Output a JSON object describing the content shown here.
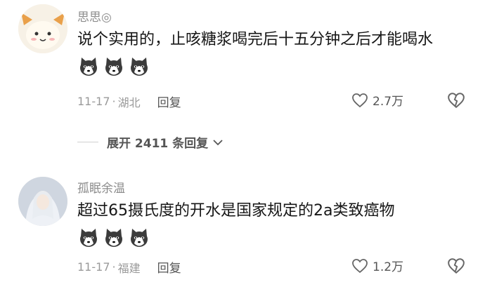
{
  "comments": [
    {
      "username": "思思◎",
      "text": "说个实用的，止咳糖浆喝完后十五分钟之后才能喝水",
      "emoji_count": 3,
      "emoji_icon": "husky-dog-emoji",
      "date": "11-17",
      "separator": "·",
      "location": "湖北",
      "reply_label": "回复",
      "likes": "2.7万"
    },
    {
      "username": "孤眠余温",
      "text": "超过65摄氏度的开水是国家规定的2a类致癌物",
      "emoji_count": 3,
      "emoji_icon": "husky-dog-emoji",
      "date": "11-17",
      "separator": "·",
      "location": "福建",
      "reply_label": "回复",
      "likes": "1.2万"
    }
  ],
  "expand_replies": {
    "label": "展开 2411 条回复"
  },
  "colors": {
    "muted": "#9a9a9a",
    "text": "#161616",
    "action": "#555555"
  }
}
